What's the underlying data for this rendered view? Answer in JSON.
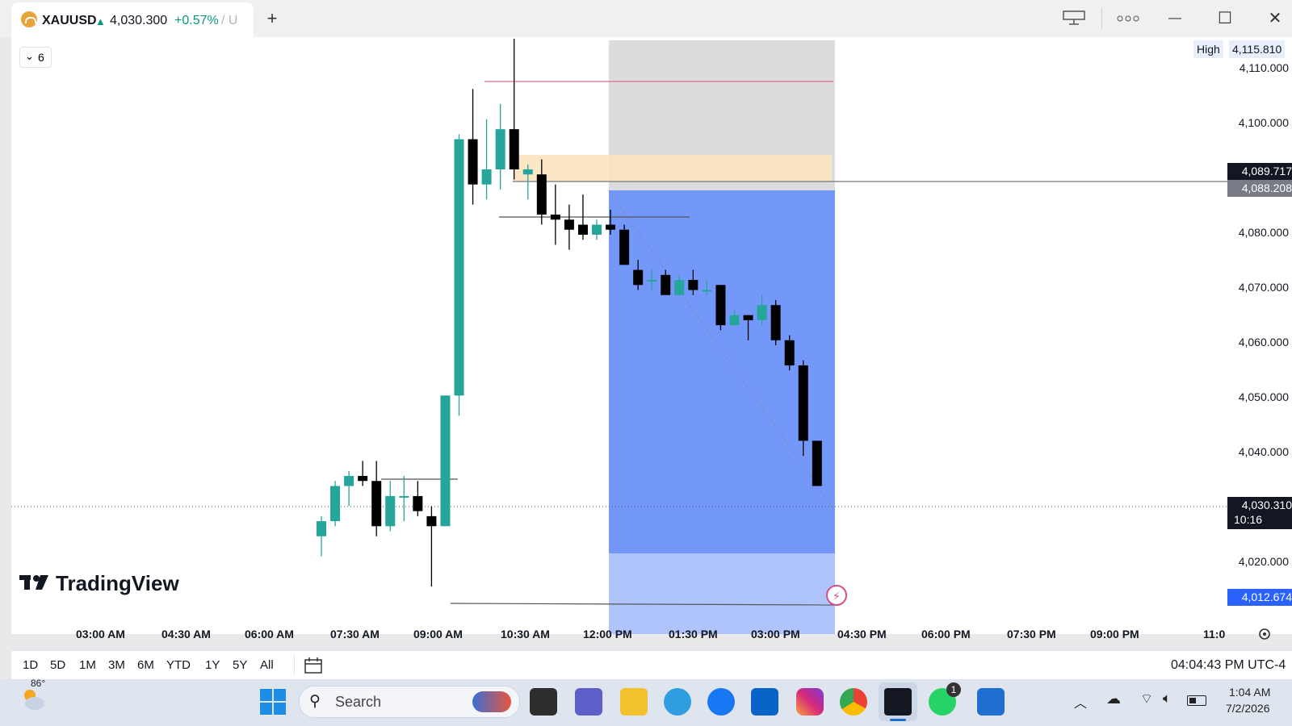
{
  "window": {
    "symbol": "XAUUSD",
    "up_arrow": "▲",
    "price": "4,030.300",
    "change": "+0.57%",
    "suffix": "/ U",
    "new_tab": "+",
    "minimize": "—",
    "maximize": "☐",
    "close": "✕"
  },
  "chart": {
    "interval": "6",
    "high_label": "High",
    "high_value": "4,115.810",
    "price_scale": [
      "4,110.000",
      "4,100.000",
      "4,080.000",
      "4,070.000",
      "4,060.000",
      "4,050.000",
      "4,040.000",
      "4,020.000"
    ],
    "tag_1": "4,089.717",
    "tag_2": "4,088.208",
    "current_price": "4,030.310",
    "countdown": "10:16",
    "bottom_tag": "4,012.674",
    "time_scale": [
      "03:00 AM",
      "04:30 AM",
      "06:00 AM",
      "07:30 AM",
      "09:00 AM",
      "10:30 AM",
      "12:00 PM",
      "01:30 PM",
      "03:00 PM",
      "04:30 PM",
      "06:00 PM",
      "07:30 PM",
      "09:00 PM",
      "11:0"
    ],
    "logo_text": "TradingView"
  },
  "chart_data": {
    "type": "candlestick",
    "y_range": [
      4005,
      4118
    ],
    "candles": [
      {
        "o": 4019,
        "h": 4023,
        "l": 4015,
        "c": 4022
      },
      {
        "o": 4022,
        "h": 4030,
        "l": 4021,
        "c": 4029
      },
      {
        "o": 4029,
        "h": 4032,
        "l": 4025,
        "c": 4031
      },
      {
        "o": 4031,
        "h": 4034,
        "l": 4029,
        "c": 4030
      },
      {
        "o": 4030,
        "h": 4034,
        "l": 4019,
        "c": 4021
      },
      {
        "o": 4021,
        "h": 4030,
        "l": 4020,
        "c": 4027
      },
      {
        "o": 4027,
        "h": 4031,
        "l": 4022,
        "c": 4027
      },
      {
        "o": 4027,
        "h": 4030,
        "l": 4023,
        "c": 4024
      },
      {
        "o": 4023,
        "h": 4025,
        "l": 4009,
        "c": 4021
      },
      {
        "o": 4021,
        "h": 4047,
        "l": 4021,
        "c": 4047
      },
      {
        "o": 4047,
        "h": 4099,
        "l": 4043,
        "c": 4098
      },
      {
        "o": 4098,
        "h": 4108,
        "l": 4085,
        "c": 4089
      },
      {
        "o": 4089,
        "h": 4102,
        "l": 4086,
        "c": 4092
      },
      {
        "o": 4092,
        "h": 4105,
        "l": 4088,
        "c": 4100
      },
      {
        "o": 4100,
        "h": 4118,
        "l": 4090,
        "c": 4092
      },
      {
        "o": 4091,
        "h": 4093,
        "l": 4086,
        "c": 4092
      },
      {
        "o": 4091,
        "h": 4094,
        "l": 4081,
        "c": 4083
      },
      {
        "o": 4083,
        "h": 4089,
        "l": 4077,
        "c": 4082
      },
      {
        "o": 4082,
        "h": 4085,
        "l": 4076,
        "c": 4080
      },
      {
        "o": 4081,
        "h": 4087,
        "l": 4078,
        "c": 4079
      },
      {
        "o": 4079,
        "h": 4082,
        "l": 4078,
        "c": 4081
      },
      {
        "o": 4081,
        "h": 4084,
        "l": 4079,
        "c": 4080
      },
      {
        "o": 4080,
        "h": 4081,
        "l": 4073,
        "c": 4073
      },
      {
        "o": 4072,
        "h": 4074,
        "l": 4068,
        "c": 4069
      },
      {
        "o": 4070,
        "h": 4072,
        "l": 4068,
        "c": 4070
      },
      {
        "o": 4071,
        "h": 4072,
        "l": 4067,
        "c": 4067
      },
      {
        "o": 4067,
        "h": 4071,
        "l": 4067,
        "c": 4070
      },
      {
        "o": 4070,
        "h": 4072,
        "l": 4067,
        "c": 4068
      },
      {
        "o": 4068,
        "h": 4070,
        "l": 4067,
        "c": 4068
      },
      {
        "o": 4069,
        "h": 4069,
        "l": 4060,
        "c": 4061
      },
      {
        "o": 4061,
        "h": 4064,
        "l": 4061,
        "c": 4063
      },
      {
        "o": 4063,
        "h": 4063,
        "l": 4058,
        "c": 4062
      },
      {
        "o": 4062,
        "h": 4067,
        "l": 4061,
        "c": 4065
      },
      {
        "o": 4065,
        "h": 4066,
        "l": 4057,
        "c": 4058
      },
      {
        "o": 4058,
        "h": 4059,
        "l": 4052,
        "c": 4053
      },
      {
        "o": 4053,
        "h": 4054,
        "l": 4035,
        "c": 4038
      },
      {
        "o": 4038,
        "h": 4038,
        "l": 4029,
        "c": 4029
      }
    ]
  },
  "bottom": {
    "ranges": [
      "1D",
      "5D",
      "1M",
      "3M",
      "6M",
      "YTD",
      "1Y",
      "5Y",
      "All"
    ],
    "clock": "04:04:43 PM UTC-4"
  },
  "taskbar": {
    "weather_temp": "86°",
    "search_placeholder": "Search",
    "time": "1:04 AM",
    "date": "7/2/2026",
    "whatsapp_badge": "1"
  }
}
